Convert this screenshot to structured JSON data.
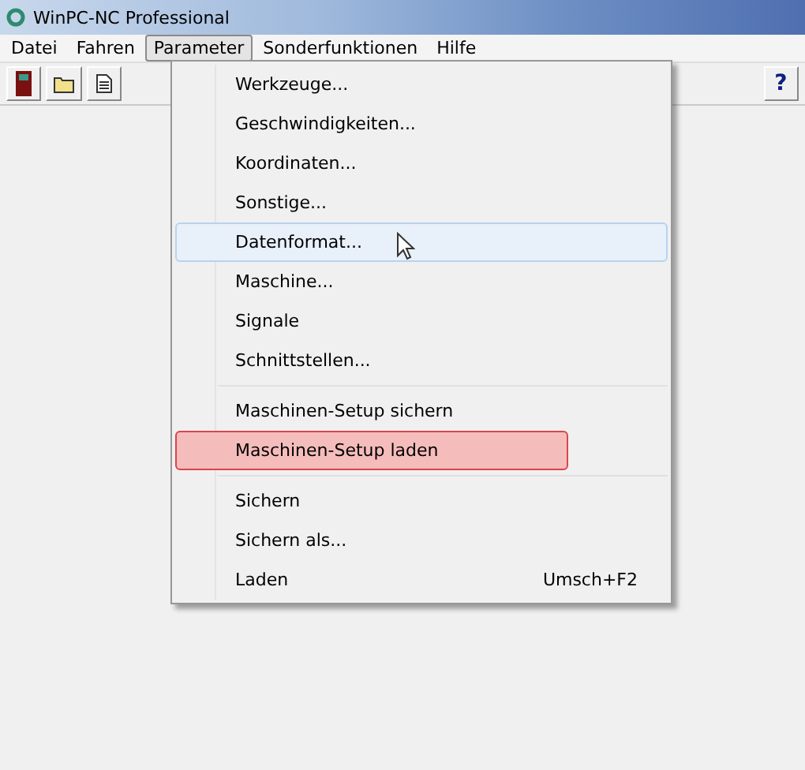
{
  "window": {
    "title": "WinPC-NC Professional"
  },
  "menubar": [
    {
      "label": "Datei",
      "selected": false
    },
    {
      "label": "Fahren",
      "selected": false
    },
    {
      "label": "Parameter",
      "selected": true
    },
    {
      "label": "Sonderfunktionen",
      "selected": false
    },
    {
      "label": "Hilfe",
      "selected": false
    }
  ],
  "toolbar": [
    {
      "kind": "door"
    },
    {
      "kind": "folder"
    },
    {
      "kind": "document"
    },
    {
      "kind": "help",
      "label": "?"
    }
  ],
  "menu": {
    "sections": [
      [
        {
          "label": "Werkzeuge...",
          "hovered": false,
          "marked": false
        },
        {
          "label": "Geschwindigkeiten...",
          "hovered": false,
          "marked": false
        },
        {
          "label": "Koordinaten...",
          "hovered": false,
          "marked": false
        },
        {
          "label": "Sonstige...",
          "hovered": false,
          "marked": false
        },
        {
          "label": "Datenformat...",
          "hovered": true,
          "marked": false
        },
        {
          "label": "Maschine...",
          "hovered": false,
          "marked": false
        },
        {
          "label": "Signale",
          "hovered": false,
          "marked": false
        },
        {
          "label": "Schnittstellen...",
          "hovered": false,
          "marked": false
        }
      ],
      [
        {
          "label": "Maschinen-Setup sichern",
          "hovered": false,
          "marked": false
        },
        {
          "label": "Maschinen-Setup laden",
          "hovered": false,
          "marked": true
        }
      ],
      [
        {
          "label": "Sichern",
          "hovered": false,
          "marked": false
        },
        {
          "label": "Sichern als...",
          "hovered": false,
          "marked": false
        },
        {
          "label": "Laden",
          "shortcut": "Umsch+F2",
          "hovered": false,
          "marked": false
        }
      ]
    ]
  }
}
